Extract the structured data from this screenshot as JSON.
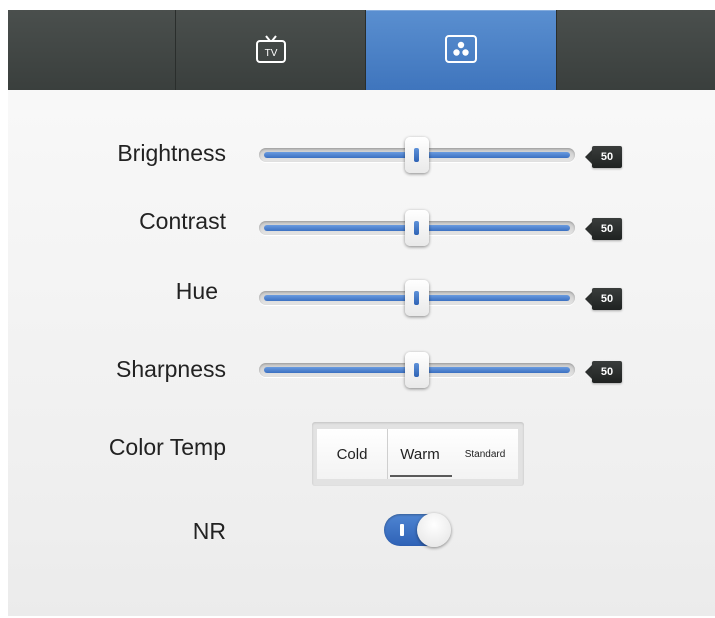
{
  "tabs": [
    {
      "icon": "tv-icon",
      "label": "TV",
      "active": false
    },
    {
      "icon": "picture-settings-icon",
      "active": true
    }
  ],
  "sliders": [
    {
      "label": "Brightness",
      "value": 50
    },
    {
      "label": "Contrast",
      "value": 50
    },
    {
      "label": "Hue",
      "value": 50
    },
    {
      "label": "Sharpness",
      "value": 50
    }
  ],
  "color_temp": {
    "label": "Color Temp",
    "options": [
      "Cold",
      "Warm",
      "Standard"
    ],
    "selected": "Warm"
  },
  "nr": {
    "label": "NR",
    "on": true
  },
  "colors": {
    "accent": "#3f75bd",
    "tab_bar": "#424745",
    "badge": "#2a2d2c"
  }
}
